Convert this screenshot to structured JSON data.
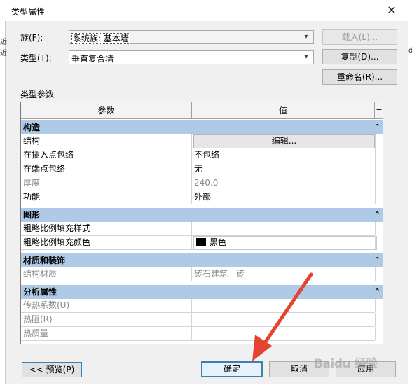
{
  "window": {
    "title": "类型属性",
    "close_glyph": "✕"
  },
  "background_text": {
    "left_a": "近",
    "left_b": "近",
    "right": "d"
  },
  "form": {
    "family_label": "族(F):",
    "family_value": "系统族: 基本墙",
    "type_label": "类型(T):",
    "type_value": "垂直复合墙",
    "load_button": "载入(L)...",
    "duplicate_button": "复制(D)...",
    "rename_button": "重命名(R)...",
    "section_label": "类型参数"
  },
  "grid": {
    "col_param": "参数",
    "col_value": "值",
    "col_eq": "=",
    "sections": [
      {
        "title": "构造",
        "chevron": "⌃",
        "rows": [
          {
            "param": "结构",
            "value": "编辑...",
            "kind": "button"
          },
          {
            "param": "在插入点包络",
            "value": "不包络"
          },
          {
            "param": "在端点包络",
            "value": "无"
          },
          {
            "param": "厚度",
            "value": "240.0",
            "disabled": true
          },
          {
            "param": "功能",
            "value": "外部"
          }
        ]
      },
      {
        "title": "图形",
        "chevron": "⌃",
        "rows": [
          {
            "param": "粗略比例填充样式",
            "value": ""
          },
          {
            "param": "粗略比例填充颜色",
            "value": "黑色",
            "kind": "color",
            "color": "#000000"
          }
        ]
      },
      {
        "title": "材质和装饰",
        "chevron": "⌃",
        "rows": [
          {
            "param": "结构材质",
            "value": "砖石建筑 - 砖",
            "disabled": true
          }
        ]
      },
      {
        "title": "分析属性",
        "chevron": "⌃",
        "rows": [
          {
            "param": "传热系数(U)",
            "value": "",
            "disabled": true
          },
          {
            "param": "热阻(R)",
            "value": "",
            "disabled": true
          },
          {
            "param": "热质量",
            "value": "",
            "disabled": true
          }
        ]
      }
    ]
  },
  "footer": {
    "preview_button": "<< 预览(P)",
    "ok_button": "确定",
    "cancel_button": "取消",
    "apply_button": "应用"
  },
  "watermark": "Baidu 经验",
  "colors": {
    "section_bg": "#aecae6",
    "arrow": "#e5432f",
    "default_border": "#3c7fb1"
  }
}
